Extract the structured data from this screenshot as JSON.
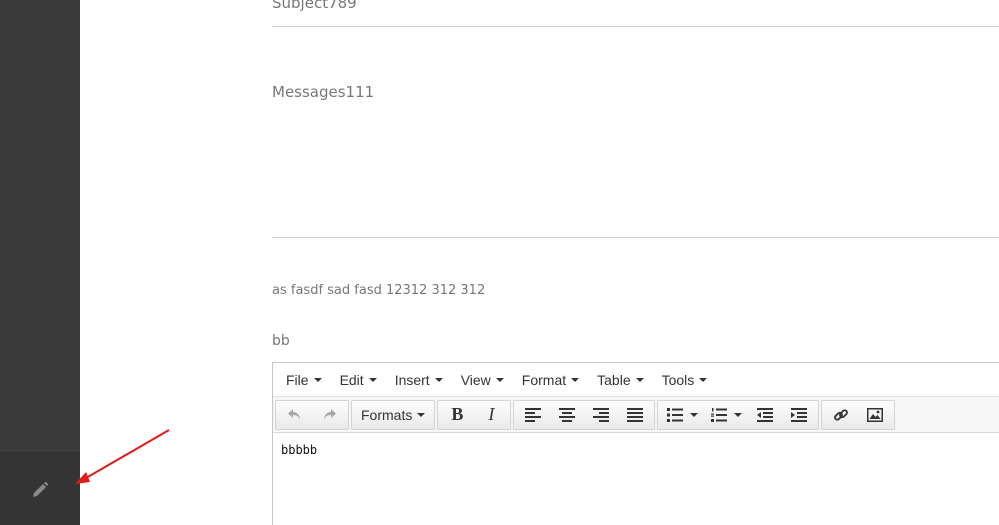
{
  "sidebar": {
    "edit_icon": "pencil-icon"
  },
  "form": {
    "subject": "Subject789",
    "messages": "Messages111",
    "body_text": "as fasdf sad fasd 12312 312 312",
    "bb": "bb"
  },
  "editor": {
    "menu": [
      {
        "label": "File"
      },
      {
        "label": "Edit"
      },
      {
        "label": "Insert"
      },
      {
        "label": "View"
      },
      {
        "label": "Format"
      },
      {
        "label": "Table"
      },
      {
        "label": "Tools"
      }
    ],
    "toolbar": {
      "undo_icon": "undo-icon",
      "redo_icon": "redo-icon",
      "formats_label": "Formats",
      "bold_label": "B",
      "italic_label": "I"
    },
    "content": "bbbbb"
  },
  "colors": {
    "sidebar": "#3b3a3a",
    "annotation_arrow": "#e01b1b"
  }
}
